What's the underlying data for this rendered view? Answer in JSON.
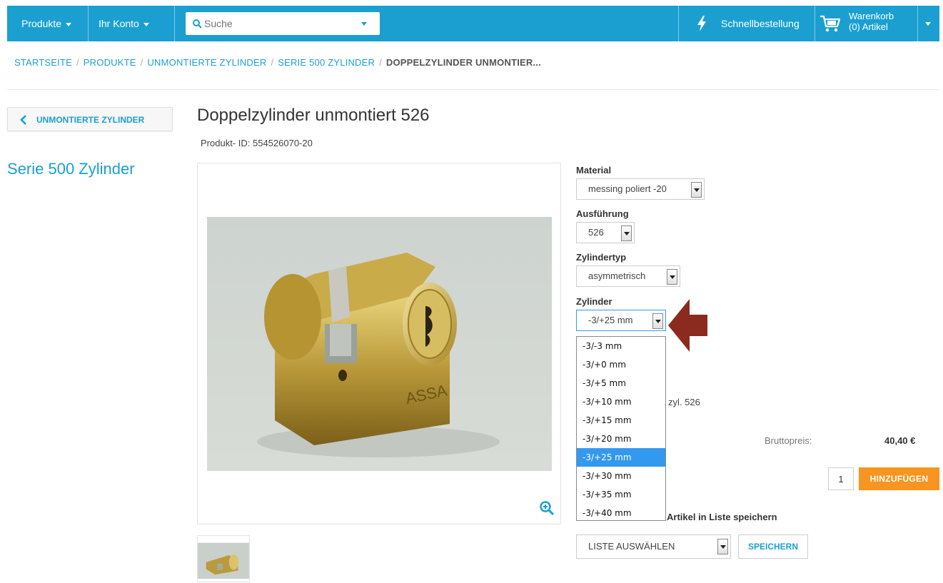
{
  "nav": {
    "products": "Produkte",
    "account": "Ihr Konto",
    "search_placeholder": "Suche",
    "quick_order": "Schnellbestellung",
    "cart_title": "Warenkorb",
    "cart_count": "(0) Artikel"
  },
  "breadcrumb": {
    "items": [
      "STARTSEITE",
      "PRODUKTE",
      "UNMONTIERTE ZYLINDER",
      "SERIE 500 ZYLINDER"
    ],
    "current": "DOPPELZYLINDER UNMONTIER..."
  },
  "sidebar": {
    "back_label": "UNMONTIERTE ZYLINDER",
    "category_title": "Serie 500 Zylinder"
  },
  "product": {
    "title": "Doppelzylinder unmontiert 526",
    "id_label": "Produkt- ID:",
    "id_value": "554526070-20",
    "photo_brand_text": "ASSA"
  },
  "options": {
    "material": {
      "label": "Material",
      "value": "messing poliert -20"
    },
    "ausfuehrung": {
      "label": "Ausführung",
      "value": "526"
    },
    "zylindertyp": {
      "label": "Zylindertyp",
      "value": "asymmetrisch"
    },
    "zylinder": {
      "label": "Zylinder",
      "value": "-3/+25 mm",
      "options": [
        "-3/-3 mm",
        "-3/+0 mm",
        "-3/+5 mm",
        "-3/+10 mm",
        "-3/+15 mm",
        "-3/+20 mm",
        "-3/+25 mm",
        "-3/+30 mm",
        "-3/+35 mm",
        "-3/+40 mm"
      ],
      "selected_index": 6
    }
  },
  "partially_hidden_text": "zyl. 526",
  "price": {
    "label": "Bruttopreis:",
    "value": "40,40 €"
  },
  "cart": {
    "quantity": "1",
    "add_label": "HINZUFÜGEN"
  },
  "save_list": {
    "label": "Artikel in Liste speichern",
    "select_value": "LISTE AUSWÄHLEN",
    "save_label": "SPEICHERN"
  },
  "colors": {
    "primary": "#1a9fd0",
    "accent_orange": "#f79520",
    "arrow_red": "#8b2a1f",
    "dropdown_highlight": "#3399ee"
  },
  "icons": [
    "search-icon",
    "bolt-icon",
    "cart-icon",
    "chevron-left-icon",
    "zoom-in-icon",
    "red-arrow-annotation"
  ]
}
